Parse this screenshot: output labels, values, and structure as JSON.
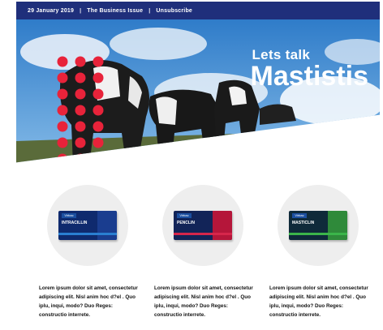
{
  "topbar": {
    "date": "29 January 2019",
    "issue": "The Business Issue",
    "unsubscribe": "Unsubscribe"
  },
  "hero": {
    "kicker": "Lets talk",
    "title": "Mastistis"
  },
  "products": [
    {
      "brand": "Virbac",
      "name": "INTRACILLIN",
      "accent": "#2a7fd1",
      "text": "Lorem ipsum dolor sit amet, consectetur adipiscing elit. Nisl anim hoc d?el . Quo iplu, inqui, modo? Duo Reges: constructio interrete."
    },
    {
      "brand": "Virbac",
      "name": "PENCLIN",
      "accent": "#d6264b",
      "text": "Lorem ipsum dolor sit amet, consectetur adipiscing elit. Nisl anim hoc d?el . Quo iplu, inqui, modo? Duo Reges: constructio interrete."
    },
    {
      "brand": "Virbac",
      "name": "MASTICLIN",
      "accent": "#3bb54a",
      "text": "Lorem ipsum dolor sit amet, consectetur adipiscing elit. Nisl anim hoc d?el . Quo iplu, inqui, modo? Duo Reges: constructio interrete."
    }
  ],
  "colors": {
    "topbar": "#1f2f7b",
    "dots": "#e8233a"
  }
}
